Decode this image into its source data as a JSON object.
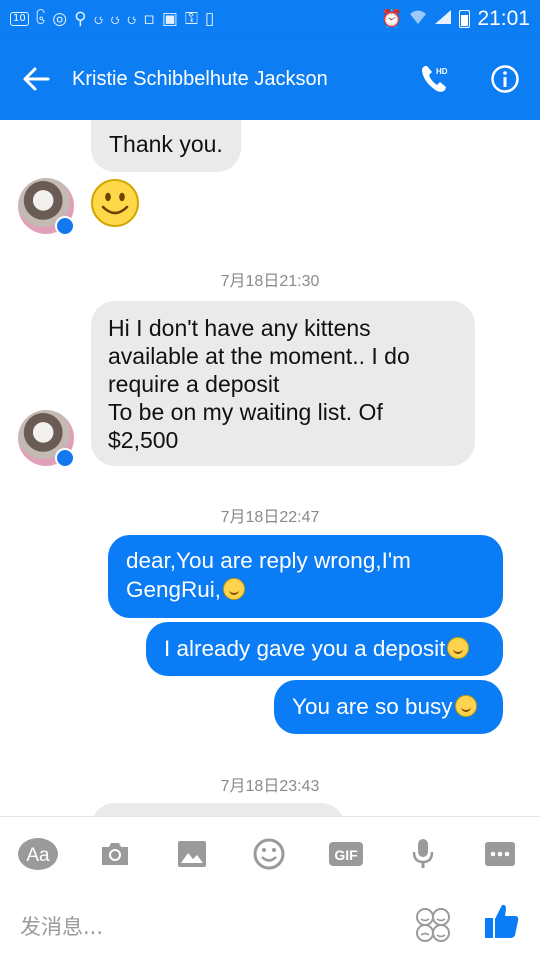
{
  "status_bar": {
    "notification_count": "10",
    "time": "21:01"
  },
  "header": {
    "title": "Kristie Schibbelhute Jackson",
    "icons": [
      "back-arrow-icon",
      "hd-call-icon",
      "info-icon"
    ]
  },
  "messages": {
    "m1_text": "Thank you.",
    "ts1": "7月18日21:30",
    "m2_lines": [
      "Hi I don't have any kittens",
      "available at the moment.. I do",
      "require a deposit",
      "To be on my waiting list. Of",
      "$2,500"
    ],
    "ts2": "7月18日22:47",
    "m3_lines": [
      "dear,You are reply wrong,I'm",
      "GengRui,"
    ],
    "m4_text": "I already gave you a deposit",
    "m5_text": "You are so busy",
    "ts3": "7月18日23:43"
  },
  "composer": {
    "aa_label": "Aa",
    "gif_label": "GIF",
    "placeholder": "发消息..."
  },
  "colors": {
    "brand_blue": "#0c7df2",
    "outgoing_bubble": "#0a7cf5",
    "incoming_bubble": "#eaeaea"
  }
}
